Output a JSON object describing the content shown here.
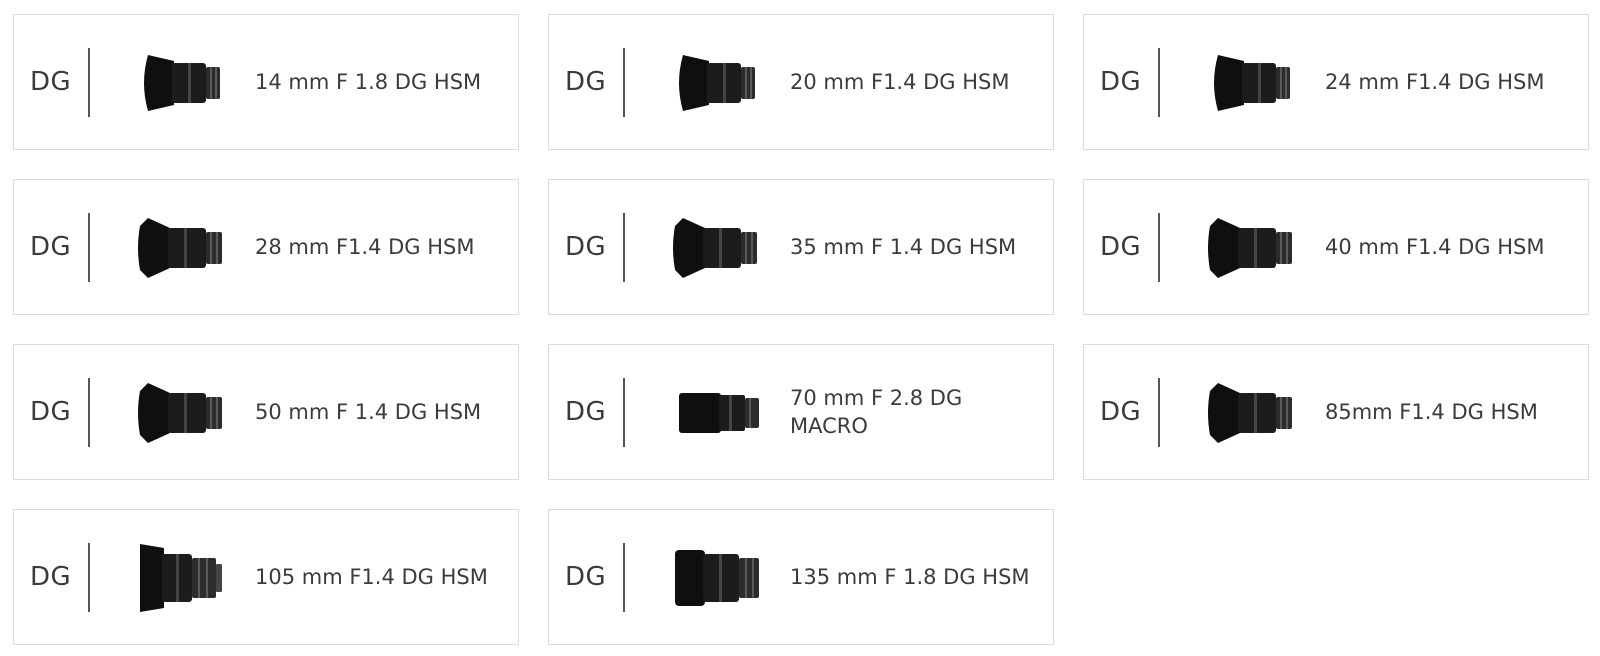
{
  "products": [
    {
      "badge": "DG",
      "name": "14 mm F 1.8 DG HSM",
      "icon": "lens-wide-hood-icon",
      "lens_style": "wide"
    },
    {
      "badge": "DG",
      "name": "20 mm F1.4 DG HSM",
      "icon": "lens-wide-hood-icon",
      "lens_style": "wide"
    },
    {
      "badge": "DG",
      "name": "24 mm F1.4 DG HSM",
      "icon": "lens-wide-hood-icon",
      "lens_style": "wide"
    },
    {
      "badge": "DG",
      "name": "28 mm F1.4 DG HSM",
      "icon": "lens-petal-hood-icon",
      "lens_style": "petal"
    },
    {
      "badge": "DG",
      "name": "35 mm F 1.4 DG HSM",
      "icon": "lens-petal-hood-icon",
      "lens_style": "petal"
    },
    {
      "badge": "DG",
      "name": "40 mm F1.4 DG HSM",
      "icon": "lens-petal-hood-icon",
      "lens_style": "petal"
    },
    {
      "badge": "DG",
      "name": "50 mm F 1.4 DG HSM",
      "icon": "lens-petal-hood-icon",
      "lens_style": "petal"
    },
    {
      "badge": "DG",
      "name": "70 mm F 2.8 DG MACRO",
      "icon": "lens-macro-icon",
      "lens_style": "macro"
    },
    {
      "badge": "DG",
      "name": "85mm F1.4 DG HSM",
      "icon": "lens-petal-hood-icon",
      "lens_style": "petal"
    },
    {
      "badge": "DG",
      "name": "105 mm F1.4 DG HSM",
      "icon": "lens-telephoto-hood-icon",
      "lens_style": "tele"
    },
    {
      "badge": "DG",
      "name": "135 mm F 1.8 DG HSM",
      "icon": "lens-telephoto-icon",
      "lens_style": "tele2"
    }
  ],
  "colors": {
    "border": "#dcdcdc",
    "text": "#3b3b3b",
    "lens": "#1c1c1c"
  }
}
